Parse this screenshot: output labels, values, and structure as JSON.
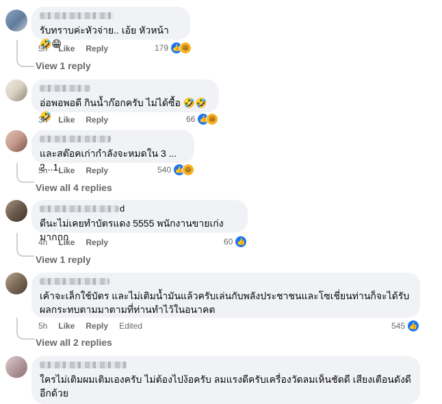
{
  "comments": [
    {
      "text": "รับทราบค่ะหัวจ่าย.. เอ้ย หัวหน้า 🤣😁",
      "time": "5h",
      "like": "Like",
      "reply": "Reply",
      "edited": "",
      "reaction_count": "179",
      "reactions": [
        "like",
        "haha"
      ],
      "replies_link": "View 1 reply",
      "avatar_colors": [
        "#8fa6c4",
        "#5f7a9a",
        "#c2ccd6"
      ]
    },
    {
      "text": "อ่อพอพอดี กินน้ำก๊อกครับ ไม่ได้ซื้อ 🤣🤣🤣",
      "time": "3h",
      "like": "Like",
      "reply": "Reply",
      "edited": "",
      "reaction_count": "66",
      "reactions": [
        "like",
        "haha"
      ],
      "replies_link": "",
      "avatar_colors": [
        "#d9d2c3",
        "#8a8373",
        "#efeae0"
      ]
    },
    {
      "text": "และสต๊อคเก่ากำลังจะหมดใน 3 ... 2...1",
      "time": "5h",
      "like": "Like",
      "reply": "Reply",
      "edited": "",
      "reaction_count": "540",
      "reactions": [
        "like",
        "haha"
      ],
      "replies_link": "View all 4 replies",
      "avatar_colors": [
        "#c49a8c",
        "#7a4f4a",
        "#e2c1b0"
      ]
    },
    {
      "text": "ดีนะไม่เคยทำบัตรแดง 5555 พนักงานขายเก่งมากกก",
      "time": "4h",
      "like": "Like",
      "reply": "Reply",
      "edited": "",
      "reaction_count": "60",
      "reactions": [
        "like"
      ],
      "replies_link": "View 1 reply",
      "name_suffix": "d",
      "avatar_colors": [
        "#6b5a4c",
        "#a89380",
        "#3f352c"
      ]
    },
    {
      "text": "เค้าจะเล็กใช้บัตร และไม่เติมน้ำมันแล้วครับเล่นกับพลังประชาชนและโซเชี่ยนท่านก็จะได้รับผลกระทบตามมาตามที่ท่านทำไว้ในอนาคต",
      "time": "5h",
      "like": "Like",
      "reply": "Reply",
      "edited": "Edited",
      "reaction_count": "545",
      "reactions": [
        "like"
      ],
      "replies_link": "View all 2 replies",
      "avatar_colors": [
        "#7d6a58",
        "#b8a58f",
        "#4d3f33"
      ]
    },
    {
      "text": "ใครไม่เติมผมเติมเองครับ ไม่ต้องไปง้อครับ ลมแรงดีครับเครื่องวัดลมเห็นชัดดี เสียงเตือนดังดีอีกด้วย",
      "time": "",
      "like": "",
      "reply": "",
      "edited": "",
      "reaction_count": "",
      "reactions": [],
      "replies_link": "",
      "avatar_colors": [
        "#b59aa0",
        "#e0cdd0",
        "#8c6f76"
      ]
    }
  ]
}
